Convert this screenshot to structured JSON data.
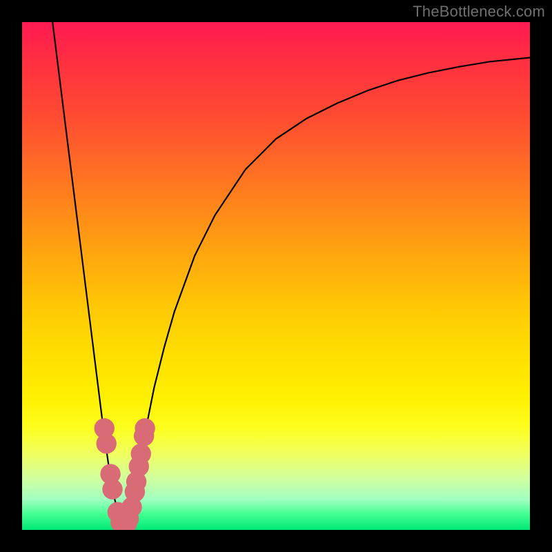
{
  "watermark": "TheBottleneck.com",
  "chart_data": {
    "type": "line",
    "title": "",
    "xlabel": "",
    "ylabel": "",
    "xlim": [
      0,
      100
    ],
    "ylim": [
      0,
      100
    ],
    "grid": false,
    "notch_x": 20,
    "series": [
      {
        "name": "curve",
        "x": [
          6,
          8,
          10,
          12,
          14,
          15,
          16,
          17,
          18,
          19,
          20,
          21,
          22,
          23,
          24,
          26,
          28,
          30,
          34,
          38,
          44,
          50,
          56,
          62,
          68,
          74,
          80,
          86,
          92,
          100
        ],
        "y": [
          100,
          84,
          68,
          52,
          36,
          28,
          20,
          13,
          7,
          3,
          0,
          3,
          7,
          12,
          18,
          28,
          36,
          43,
          54,
          62,
          71,
          77,
          81,
          84,
          86.5,
          88.5,
          90,
          91.2,
          92.2,
          93
        ]
      }
    ],
    "markers": {
      "color": "#d86b75",
      "radius": 2.0,
      "points": [
        {
          "x": 16.2,
          "y": 20
        },
        {
          "x": 16.6,
          "y": 17
        },
        {
          "x": 17.4,
          "y": 11
        },
        {
          "x": 17.8,
          "y": 8
        },
        {
          "x": 18.8,
          "y": 3.5
        },
        {
          "x": 19.4,
          "y": 1.5
        },
        {
          "x": 20.0,
          "y": 0.8
        },
        {
          "x": 20.6,
          "y": 1.2
        },
        {
          "x": 21.0,
          "y": 2.2
        },
        {
          "x": 21.6,
          "y": 4.5
        },
        {
          "x": 22.2,
          "y": 7.5
        },
        {
          "x": 22.5,
          "y": 9.5
        },
        {
          "x": 23.0,
          "y": 12.5
        },
        {
          "x": 23.4,
          "y": 15
        },
        {
          "x": 24.0,
          "y": 18.5
        },
        {
          "x": 24.2,
          "y": 20
        }
      ]
    },
    "gradient_stops": [
      {
        "pos": 0,
        "color": "#ff1a52"
      },
      {
        "pos": 8,
        "color": "#ff3040"
      },
      {
        "pos": 20,
        "color": "#ff5030"
      },
      {
        "pos": 32,
        "color": "#ff7820"
      },
      {
        "pos": 44,
        "color": "#ffa010"
      },
      {
        "pos": 56,
        "color": "#ffc805"
      },
      {
        "pos": 66,
        "color": "#ffe000"
      },
      {
        "pos": 74,
        "color": "#fff000"
      },
      {
        "pos": 80,
        "color": "#fdff20"
      },
      {
        "pos": 85,
        "color": "#f0ff60"
      },
      {
        "pos": 90,
        "color": "#d0ffa0"
      },
      {
        "pos": 94,
        "color": "#a0ffc0"
      },
      {
        "pos": 97,
        "color": "#40ff90"
      },
      {
        "pos": 100,
        "color": "#00e878"
      }
    ]
  }
}
